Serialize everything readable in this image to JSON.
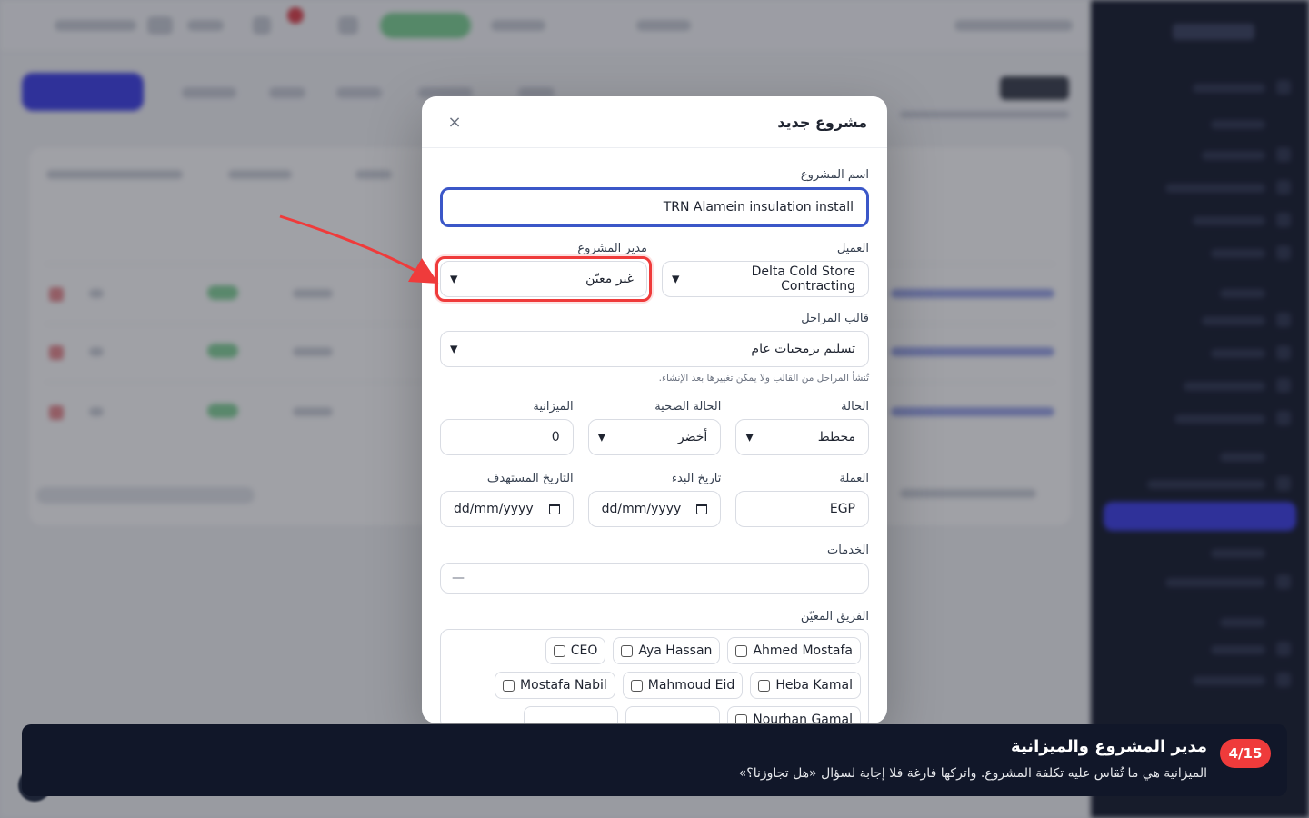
{
  "modal": {
    "title": "مشروع جديد",
    "close_icon": "×",
    "project_name": {
      "label": "اسم المشروع",
      "value": "TRN Alamein insulation install"
    },
    "client": {
      "label": "العميل",
      "value": "Delta Cold Store Contracting"
    },
    "project_manager": {
      "label": "مدير المشروع",
      "value": "غير معيّن"
    },
    "phase_template": {
      "label": "قالب المراحل",
      "value": "تسليم برمجيات عام",
      "hint": "تُنشأ المراحل من القالب ولا يمكن تغييرها بعد الإنشاء."
    },
    "status": {
      "label": "الحالة",
      "value": "مخطط"
    },
    "health": {
      "label": "الحالة الصحية",
      "value": "أخضر"
    },
    "budget": {
      "label": "الميزانية",
      "value": "0"
    },
    "currency": {
      "label": "العملة",
      "value": "EGP"
    },
    "start_date": {
      "label": "تاريخ البدء",
      "value": "dd/mm/yyyy"
    },
    "target_date": {
      "label": "التاريخ المستهدف",
      "value": "dd/mm/yyyy"
    },
    "services": {
      "label": "الخدمات",
      "value": "—"
    },
    "team": {
      "label": "الفريق المعيّن",
      "members": [
        "Ahmed Mostafa",
        "Aya Hassan",
        "CEO",
        "Heba Kamal",
        "Mahmoud Eid",
        "Mostafa Nabil",
        "Nourhan Gamal"
      ]
    }
  },
  "tour": {
    "step": "4/15",
    "title": "مدير المشروع والميزانية",
    "description": "الميزانية هي ما تُقاس عليه تكلفة المشروع. واتركها فارغة فلا إجابة لسؤال «هل تجاوزنا؟»"
  },
  "colors": {
    "accent": "#3d3fe8",
    "highlight": "#ef3b3b",
    "focus_border": "#3b57c8",
    "tour_bg": "#111729"
  }
}
